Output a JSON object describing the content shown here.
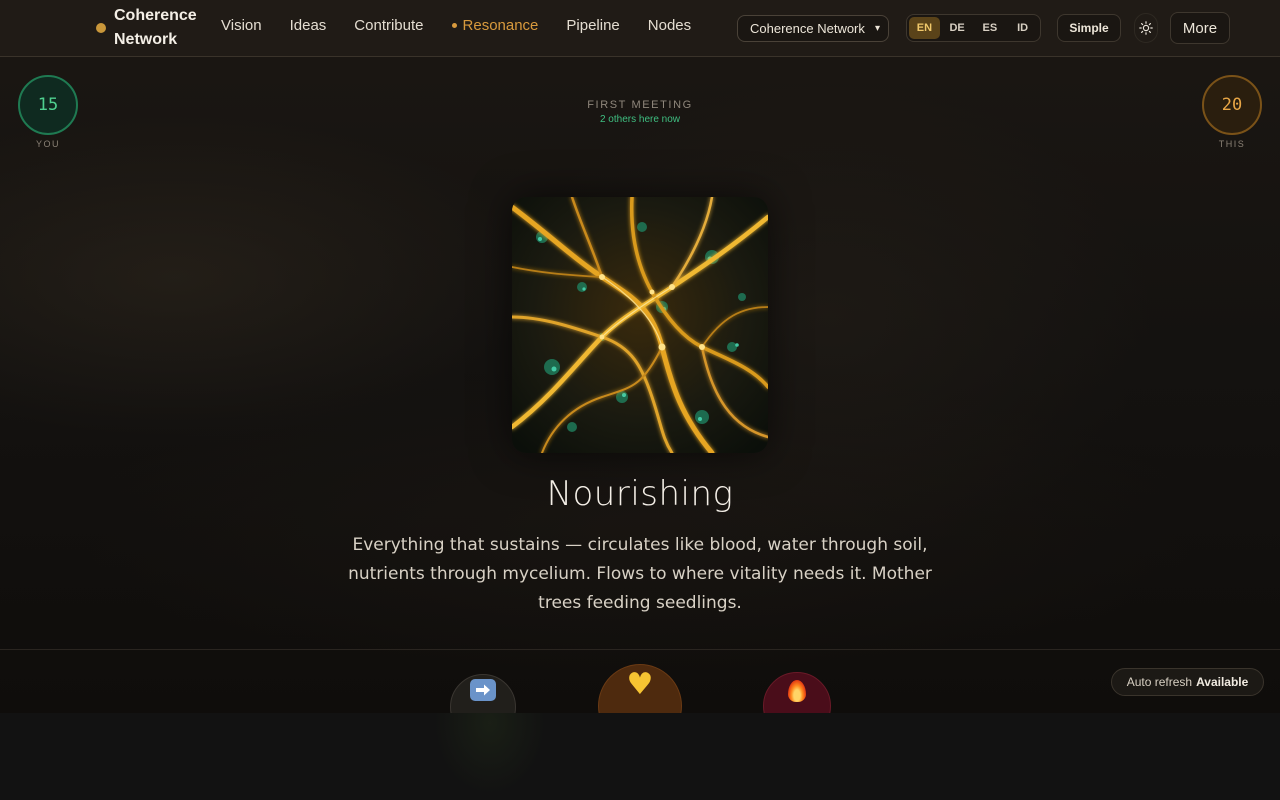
{
  "brand": {
    "name": "Coherence Network",
    "dot_color": "#c9973a"
  },
  "nav": {
    "items": [
      {
        "label": "Vision",
        "active": false
      },
      {
        "label": "Ideas",
        "active": false
      },
      {
        "label": "Contribute",
        "active": false
      },
      {
        "label": "Resonance",
        "active": true
      },
      {
        "label": "Pipeline",
        "active": false
      },
      {
        "label": "Nodes",
        "active": false
      }
    ],
    "active_color": "#d89a3d"
  },
  "network_select": {
    "selected": "Coherence Network"
  },
  "languages": {
    "options": [
      "EN",
      "DE",
      "ES",
      "ID"
    ],
    "selected": "EN"
  },
  "header_buttons": {
    "simple": "Simple",
    "theme_icon": "sun-icon",
    "more": "More"
  },
  "counters": {
    "you": {
      "value": "15",
      "label": "YOU",
      "color": "#4fd08f"
    },
    "this": {
      "value": "20",
      "label": "THIS",
      "color": "#e8a646"
    }
  },
  "meeting": {
    "title": "FIRST MEETING",
    "subtitle": "2 others here now"
  },
  "concept": {
    "title": "Nourishing",
    "description": "Everything that sustains — circulates like blood, water through soil, nutrients through mycelium. Flows to where vitality needs it. Mother trees feeding seedlings."
  },
  "reactions": [
    {
      "name": "arrow-right",
      "icon": "right-arrow-icon"
    },
    {
      "name": "heart",
      "icon": "yellow-heart-icon",
      "glyph": "♥"
    },
    {
      "name": "fire",
      "icon": "fire-icon"
    }
  ],
  "auto_refresh": {
    "label": "Auto refresh",
    "status": "Available"
  }
}
